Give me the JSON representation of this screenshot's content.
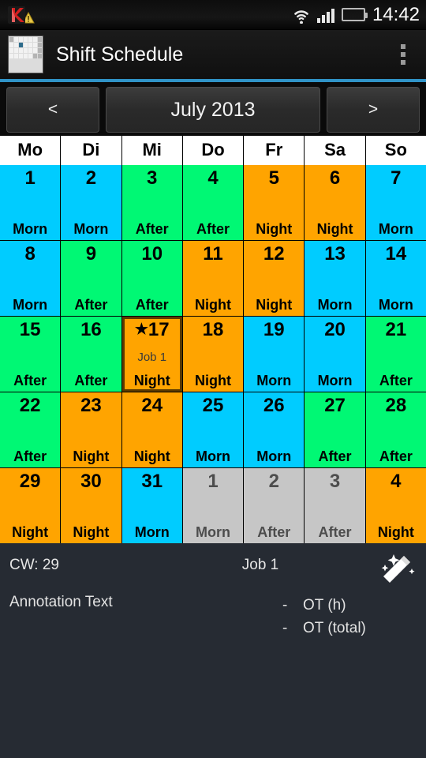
{
  "status_bar": {
    "icons": [
      "kaspersky-icon",
      "warning-icon",
      "wifi-icon",
      "signal-icon",
      "battery-icon"
    ],
    "clock": "14:42"
  },
  "action_bar": {
    "app_icon": "calendar-app-icon",
    "title": "Shift Schedule",
    "overflow": "overflow-menu-icon",
    "accent_color": "#3093c7"
  },
  "nav": {
    "prev": "<",
    "month": "July 2013",
    "next": ">"
  },
  "calendar": {
    "weekdays": [
      "Mo",
      "Di",
      "Mi",
      "Do",
      "Fr",
      "Sa",
      "So"
    ],
    "shift_colors": {
      "Morn": "#00ccff",
      "After": "#00f874",
      "Night": "#ffa400",
      "other_month": "#c6c6c6"
    },
    "days": [
      {
        "num": "1",
        "shift": "Morn",
        "type": "morn",
        "out": false,
        "star": false,
        "job": ""
      },
      {
        "num": "2",
        "shift": "Morn",
        "type": "morn",
        "out": false,
        "star": false,
        "job": ""
      },
      {
        "num": "3",
        "shift": "After",
        "type": "after",
        "out": false,
        "star": false,
        "job": ""
      },
      {
        "num": "4",
        "shift": "After",
        "type": "after",
        "out": false,
        "star": false,
        "job": ""
      },
      {
        "num": "5",
        "shift": "Night",
        "type": "night",
        "out": false,
        "star": false,
        "job": ""
      },
      {
        "num": "6",
        "shift": "Night",
        "type": "night",
        "out": false,
        "star": false,
        "job": ""
      },
      {
        "num": "7",
        "shift": "Morn",
        "type": "morn",
        "out": false,
        "star": false,
        "job": ""
      },
      {
        "num": "8",
        "shift": "Morn",
        "type": "morn",
        "out": false,
        "star": false,
        "job": ""
      },
      {
        "num": "9",
        "shift": "After",
        "type": "after",
        "out": false,
        "star": false,
        "job": ""
      },
      {
        "num": "10",
        "shift": "After",
        "type": "after",
        "out": false,
        "star": false,
        "job": ""
      },
      {
        "num": "11",
        "shift": "Night",
        "type": "night",
        "out": false,
        "star": false,
        "job": ""
      },
      {
        "num": "12",
        "shift": "Night",
        "type": "night",
        "out": false,
        "star": false,
        "job": ""
      },
      {
        "num": "13",
        "shift": "Morn",
        "type": "morn",
        "out": false,
        "star": false,
        "job": ""
      },
      {
        "num": "14",
        "shift": "Morn",
        "type": "morn",
        "out": false,
        "star": false,
        "job": ""
      },
      {
        "num": "15",
        "shift": "After",
        "type": "after",
        "out": false,
        "star": false,
        "job": ""
      },
      {
        "num": "16",
        "shift": "After",
        "type": "after",
        "out": false,
        "star": false,
        "job": ""
      },
      {
        "num": "17",
        "shift": "Night",
        "type": "night",
        "out": false,
        "star": true,
        "job": "Job 1",
        "selected": true
      },
      {
        "num": "18",
        "shift": "Night",
        "type": "night",
        "out": false,
        "star": false,
        "job": ""
      },
      {
        "num": "19",
        "shift": "Morn",
        "type": "morn",
        "out": false,
        "star": false,
        "job": ""
      },
      {
        "num": "20",
        "shift": "Morn",
        "type": "morn",
        "out": false,
        "star": false,
        "job": ""
      },
      {
        "num": "21",
        "shift": "After",
        "type": "after",
        "out": false,
        "star": false,
        "job": ""
      },
      {
        "num": "22",
        "shift": "After",
        "type": "after",
        "out": false,
        "star": false,
        "job": ""
      },
      {
        "num": "23",
        "shift": "Night",
        "type": "night",
        "out": false,
        "star": false,
        "job": ""
      },
      {
        "num": "24",
        "shift": "Night",
        "type": "night",
        "out": false,
        "star": false,
        "job": ""
      },
      {
        "num": "25",
        "shift": "Morn",
        "type": "morn",
        "out": false,
        "star": false,
        "job": ""
      },
      {
        "num": "26",
        "shift": "Morn",
        "type": "morn",
        "out": false,
        "star": false,
        "job": ""
      },
      {
        "num": "27",
        "shift": "After",
        "type": "after",
        "out": false,
        "star": false,
        "job": ""
      },
      {
        "num": "28",
        "shift": "After",
        "type": "after",
        "out": false,
        "star": false,
        "job": ""
      },
      {
        "num": "29",
        "shift": "Night",
        "type": "night",
        "out": false,
        "star": false,
        "job": ""
      },
      {
        "num": "30",
        "shift": "Night",
        "type": "night",
        "out": false,
        "star": false,
        "job": ""
      },
      {
        "num": "31",
        "shift": "Morn",
        "type": "morn",
        "out": false,
        "star": false,
        "job": ""
      },
      {
        "num": "1",
        "shift": "Morn",
        "type": "out",
        "out": true,
        "star": false,
        "job": ""
      },
      {
        "num": "2",
        "shift": "After",
        "type": "out",
        "out": true,
        "star": false,
        "job": ""
      },
      {
        "num": "3",
        "shift": "After",
        "type": "out",
        "out": true,
        "star": false,
        "job": ""
      },
      {
        "num": "4",
        "shift": "Night",
        "type": "night",
        "out": false,
        "star": false,
        "job": ""
      }
    ]
  },
  "footer": {
    "cw_label": "CW: 29",
    "job_label": "Job 1",
    "wand_icon": "magic-wand-icon",
    "annotation_text": "Annotation Text",
    "ot_rows": [
      {
        "value": "-",
        "label": "OT (h)"
      },
      {
        "value": "-",
        "label": "OT (total)"
      }
    ]
  }
}
